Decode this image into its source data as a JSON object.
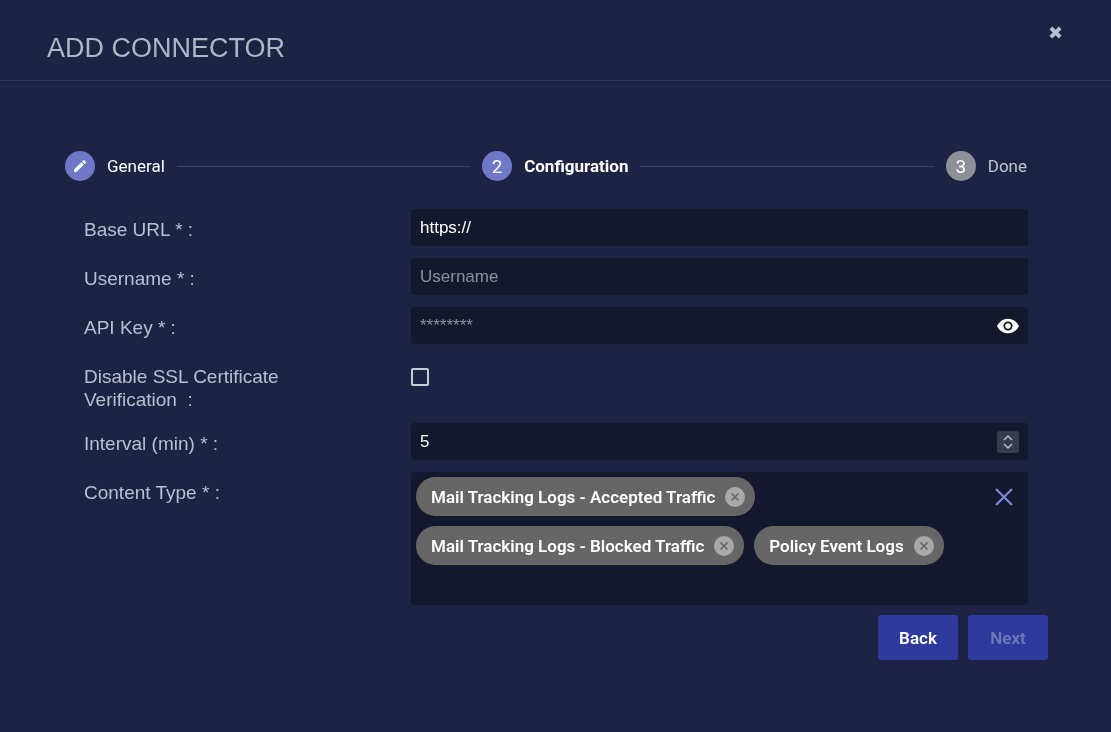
{
  "dialog": {
    "title": "ADD CONNECTOR",
    "close": "✖"
  },
  "steps": [
    {
      "label": "General",
      "completed": true,
      "selected": false
    },
    {
      "number": "2",
      "label": "Configuration",
      "completed": false,
      "selected": true
    },
    {
      "number": "3",
      "label": "Done",
      "completed": false,
      "selected": false
    }
  ],
  "fields": [
    {
      "kind": "text",
      "label": "Base URL * :",
      "value": "https://"
    },
    {
      "kind": "text",
      "label": "Username * :",
      "placeholder": "Username"
    },
    {
      "kind": "password",
      "label": "API Key * :",
      "placeholder": "********"
    },
    {
      "kind": "checkbox",
      "label": "Disable SSL Certificate Verification  :",
      "checked": false
    },
    {
      "kind": "number",
      "label": "Interval (min) * :",
      "value": "5"
    },
    {
      "kind": "tags",
      "label": "Content Type * :",
      "tags": [
        "Mail Tracking Logs - Accepted Traffic",
        "Mail Tracking Logs - Blocked Traffic",
        "Policy Event Logs"
      ]
    }
  ],
  "buttons": [
    {
      "label": "Back",
      "disabled": false
    },
    {
      "label": "Next",
      "disabled": true
    }
  ]
}
